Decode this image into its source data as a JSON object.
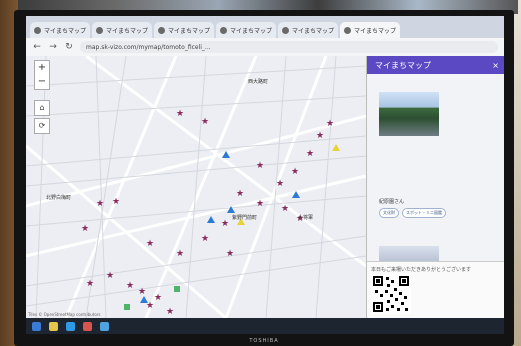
{
  "browser": {
    "tabs": [
      {
        "label": "マイまちマップ"
      },
      {
        "label": "マイまちマップ"
      },
      {
        "label": "マイまちマップ"
      },
      {
        "label": "マイまちマップ"
      },
      {
        "label": "マイまちマップ"
      },
      {
        "label": "マイまちマップ"
      }
    ],
    "url": "map.sk-vizo.com/mymap/tomoto_ficeli_..."
  },
  "map": {
    "labels": [
      "西大路町",
      "北野白梅町",
      "紫野門前町",
      "大将軍"
    ],
    "attribution": "Tiles © OpenStreetMap contributors"
  },
  "panel": {
    "title": "マイまちマップ",
    "close_label": "×",
    "spot_name": "紀原園さん",
    "chips": [
      "文化財",
      "スポット・ミニ図鑑"
    ],
    "feedback_text": "本日もご来場いただきありがとうございます"
  },
  "monitor": {
    "brand": "TOSHIBA"
  },
  "colors": {
    "panel_header": "#5b49c4",
    "marker_star": "#8a2b5e",
    "marker_blue": "#2b7bd6",
    "marker_yellow": "#e8d23a",
    "marker_green": "#4fb36a"
  }
}
